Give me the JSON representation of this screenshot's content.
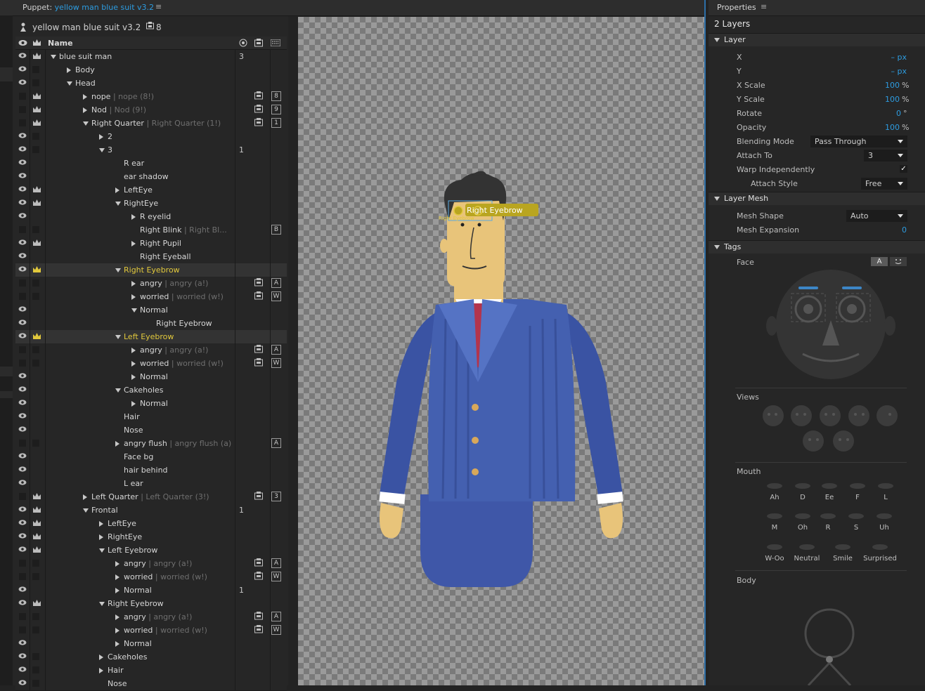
{
  "puppet_panel": {
    "title_label": "Puppet:",
    "title_value": "yellow man blue suit v3.2",
    "puppet_name": "yellow man blue suit v3.2",
    "layer_count": "8",
    "column_name": "Name",
    "rows": [
      {
        "label": "blue suit man",
        "sub": "",
        "indent": 0,
        "expand": "d",
        "eye": true,
        "crown": true,
        "num": "3",
        "key": "",
        "mic": false,
        "yellow": false,
        "sel": false
      },
      {
        "label": "Body",
        "sub": "",
        "indent": 1,
        "expand": "r",
        "eye": true,
        "crown": false,
        "num": "",
        "key": "",
        "mic": false,
        "yellow": false,
        "sel": false
      },
      {
        "label": "Head",
        "sub": "",
        "indent": 1,
        "expand": "d",
        "eye": true,
        "crown": false,
        "num": "",
        "key": "",
        "mic": false,
        "yellow": false,
        "sel": false
      },
      {
        "label": "nope",
        "sub": "nope (8!)",
        "indent": 2,
        "expand": "r",
        "eye": false,
        "crown": true,
        "num": "",
        "key": "8",
        "mic": true,
        "yellow": false,
        "sel": false
      },
      {
        "label": "Nod",
        "sub": "Nod (9!)",
        "indent": 2,
        "expand": "r",
        "eye": false,
        "crown": true,
        "num": "",
        "key": "9",
        "mic": true,
        "yellow": false,
        "sel": false
      },
      {
        "label": "Right Quarter",
        "sub": "Right Quarter (1!)",
        "indent": 2,
        "expand": "d",
        "eye": false,
        "crown": true,
        "num": "",
        "key": "1",
        "mic": true,
        "yellow": false,
        "sel": false
      },
      {
        "label": "2",
        "sub": "",
        "indent": 3,
        "expand": "r",
        "eye": true,
        "crown": false,
        "num": "",
        "key": "",
        "mic": false,
        "yellow": false,
        "sel": false
      },
      {
        "label": "3",
        "sub": "",
        "indent": 3,
        "expand": "d",
        "eye": true,
        "crown": false,
        "num": "1",
        "key": "",
        "mic": false,
        "yellow": false,
        "sel": false
      },
      {
        "label": "R ear",
        "sub": "",
        "indent": 4,
        "expand": "",
        "eye": true,
        "crown": false,
        "num": "",
        "key": "",
        "mic": false,
        "yellow": false,
        "sel": false
      },
      {
        "label": "ear shadow",
        "sub": "",
        "indent": 4,
        "expand": "",
        "eye": true,
        "crown": false,
        "num": "",
        "key": "",
        "mic": false,
        "yellow": false,
        "sel": false
      },
      {
        "label": "LeftEye",
        "sub": "",
        "indent": 4,
        "expand": "r",
        "eye": true,
        "crown": true,
        "num": "",
        "key": "",
        "mic": false,
        "yellow": false,
        "sel": false
      },
      {
        "label": "RightEye",
        "sub": "",
        "indent": 4,
        "expand": "d",
        "eye": true,
        "crown": true,
        "num": "",
        "key": "",
        "mic": false,
        "yellow": false,
        "sel": false
      },
      {
        "label": "R eyelid",
        "sub": "",
        "indent": 5,
        "expand": "r",
        "eye": true,
        "crown": false,
        "num": "",
        "key": "",
        "mic": false,
        "yellow": false,
        "sel": false
      },
      {
        "label": "Right Blink",
        "sub": "Right Bl...",
        "indent": 5,
        "expand": "",
        "eye": false,
        "crown": false,
        "num": "",
        "key": "B",
        "mic": false,
        "yellow": false,
        "sel": false
      },
      {
        "label": "Right Pupil",
        "sub": "",
        "indent": 5,
        "expand": "r",
        "eye": true,
        "crown": true,
        "num": "",
        "key": "",
        "mic": false,
        "yellow": false,
        "sel": false
      },
      {
        "label": "Right Eyeball",
        "sub": "",
        "indent": 5,
        "expand": "",
        "eye": true,
        "crown": false,
        "num": "",
        "key": "",
        "mic": false,
        "yellow": false,
        "sel": false
      },
      {
        "label": "Right Eyebrow",
        "sub": "",
        "indent": 4,
        "expand": "d",
        "eye": true,
        "crown": true,
        "num": "",
        "key": "",
        "mic": false,
        "yellow": true,
        "sel": true
      },
      {
        "label": "angry",
        "sub": "angry (a!)",
        "indent": 5,
        "expand": "r",
        "eye": false,
        "crown": false,
        "num": "",
        "key": "A",
        "mic": true,
        "yellow": false,
        "sel": false
      },
      {
        "label": "worried",
        "sub": "worried (w!)",
        "indent": 5,
        "expand": "r",
        "eye": false,
        "crown": false,
        "num": "",
        "key": "W",
        "mic": true,
        "yellow": false,
        "sel": false
      },
      {
        "label": "Normal",
        "sub": "",
        "indent": 5,
        "expand": "d",
        "eye": true,
        "crown": false,
        "num": "",
        "key": "",
        "mic": false,
        "yellow": false,
        "sel": false
      },
      {
        "label": "Right Eyebrow",
        "sub": "",
        "indent": 6,
        "expand": "",
        "eye": true,
        "crown": false,
        "num": "",
        "key": "",
        "mic": false,
        "yellow": false,
        "sel": false
      },
      {
        "label": "Left Eyebrow",
        "sub": "",
        "indent": 4,
        "expand": "d",
        "eye": true,
        "crown": true,
        "num": "",
        "key": "",
        "mic": false,
        "yellow": true,
        "sel": true
      },
      {
        "label": "angry",
        "sub": "angry (a!)",
        "indent": 5,
        "expand": "r",
        "eye": false,
        "crown": false,
        "num": "",
        "key": "A",
        "mic": true,
        "yellow": false,
        "sel": false
      },
      {
        "label": "worried",
        "sub": "worried (w!)",
        "indent": 5,
        "expand": "r",
        "eye": false,
        "crown": false,
        "num": "",
        "key": "W",
        "mic": true,
        "yellow": false,
        "sel": false
      },
      {
        "label": "Normal",
        "sub": "",
        "indent": 5,
        "expand": "r",
        "eye": true,
        "crown": false,
        "num": "",
        "key": "",
        "mic": false,
        "yellow": false,
        "sel": false
      },
      {
        "label": "Cakeholes",
        "sub": "",
        "indent": 4,
        "expand": "d",
        "eye": true,
        "crown": false,
        "num": "",
        "key": "",
        "mic": false,
        "yellow": false,
        "sel": false
      },
      {
        "label": "Normal",
        "sub": "",
        "indent": 5,
        "expand": "r",
        "eye": true,
        "crown": false,
        "num": "",
        "key": "",
        "mic": false,
        "yellow": false,
        "sel": false
      },
      {
        "label": "Hair",
        "sub": "",
        "indent": 4,
        "expand": "",
        "eye": true,
        "crown": false,
        "num": "",
        "key": "",
        "mic": false,
        "yellow": false,
        "sel": false
      },
      {
        "label": "Nose",
        "sub": "",
        "indent": 4,
        "expand": "",
        "eye": true,
        "crown": false,
        "num": "",
        "key": "",
        "mic": false,
        "yellow": false,
        "sel": false
      },
      {
        "label": "angry flush",
        "sub": "angry flush (a)",
        "indent": 4,
        "expand": "r",
        "eye": false,
        "crown": false,
        "num": "",
        "key": "A",
        "mic": false,
        "yellow": false,
        "sel": false
      },
      {
        "label": "Face bg",
        "sub": "",
        "indent": 4,
        "expand": "",
        "eye": true,
        "crown": false,
        "num": "",
        "key": "",
        "mic": false,
        "yellow": false,
        "sel": false
      },
      {
        "label": "hair behind",
        "sub": "",
        "indent": 4,
        "expand": "",
        "eye": true,
        "crown": false,
        "num": "",
        "key": "",
        "mic": false,
        "yellow": false,
        "sel": false
      },
      {
        "label": "L ear",
        "sub": "",
        "indent": 4,
        "expand": "",
        "eye": true,
        "crown": false,
        "num": "",
        "key": "",
        "mic": false,
        "yellow": false,
        "sel": false
      },
      {
        "label": "Left Quarter",
        "sub": "Left Quarter (3!)",
        "indent": 2,
        "expand": "r",
        "eye": false,
        "crown": true,
        "num": "",
        "key": "3",
        "mic": true,
        "yellow": false,
        "sel": false
      },
      {
        "label": "Frontal",
        "sub": "",
        "indent": 2,
        "expand": "d",
        "eye": true,
        "crown": true,
        "num": "1",
        "key": "",
        "mic": false,
        "yellow": false,
        "sel": false
      },
      {
        "label": "LeftEye",
        "sub": "",
        "indent": 3,
        "expand": "r",
        "eye": true,
        "crown": true,
        "num": "",
        "key": "",
        "mic": false,
        "yellow": false,
        "sel": false
      },
      {
        "label": "RightEye",
        "sub": "",
        "indent": 3,
        "expand": "r",
        "eye": true,
        "crown": true,
        "num": "",
        "key": "",
        "mic": false,
        "yellow": false,
        "sel": false
      },
      {
        "label": "Left Eyebrow",
        "sub": "",
        "indent": 3,
        "expand": "d",
        "eye": true,
        "crown": true,
        "num": "",
        "key": "",
        "mic": false,
        "yellow": false,
        "sel": false
      },
      {
        "label": "angry",
        "sub": "angry (a!)",
        "indent": 4,
        "expand": "r",
        "eye": false,
        "crown": false,
        "num": "",
        "key": "A",
        "mic": true,
        "yellow": false,
        "sel": false
      },
      {
        "label": "worried",
        "sub": "worried (w!)",
        "indent": 4,
        "expand": "r",
        "eye": false,
        "crown": false,
        "num": "",
        "key": "W",
        "mic": true,
        "yellow": false,
        "sel": false
      },
      {
        "label": "Normal",
        "sub": "",
        "indent": 4,
        "expand": "r",
        "eye": true,
        "crown": false,
        "num": "1",
        "key": "",
        "mic": false,
        "yellow": false,
        "sel": false
      },
      {
        "label": "Right Eyebrow",
        "sub": "",
        "indent": 3,
        "expand": "d",
        "eye": true,
        "crown": true,
        "num": "",
        "key": "",
        "mic": false,
        "yellow": false,
        "sel": false
      },
      {
        "label": "angry",
        "sub": "angry (a!)",
        "indent": 4,
        "expand": "r",
        "eye": false,
        "crown": false,
        "num": "",
        "key": "A",
        "mic": true,
        "yellow": false,
        "sel": false
      },
      {
        "label": "worried",
        "sub": "worried (w!)",
        "indent": 4,
        "expand": "r",
        "eye": false,
        "crown": false,
        "num": "",
        "key": "W",
        "mic": true,
        "yellow": false,
        "sel": false
      },
      {
        "label": "Normal",
        "sub": "",
        "indent": 4,
        "expand": "r",
        "eye": true,
        "crown": false,
        "num": "",
        "key": "",
        "mic": false,
        "yellow": false,
        "sel": false
      },
      {
        "label": "Cakeholes",
        "sub": "",
        "indent": 3,
        "expand": "r",
        "eye": true,
        "crown": false,
        "num": "",
        "key": "",
        "mic": false,
        "yellow": false,
        "sel": false
      },
      {
        "label": "Hair",
        "sub": "",
        "indent": 3,
        "expand": "r",
        "eye": true,
        "crown": false,
        "num": "",
        "key": "",
        "mic": false,
        "yellow": false,
        "sel": false
      },
      {
        "label": "Nose",
        "sub": "",
        "indent": 3,
        "expand": "",
        "eye": true,
        "crown": false,
        "num": "",
        "key": "",
        "mic": false,
        "yellow": false,
        "sel": false
      }
    ]
  },
  "canvas": {
    "handle_label": "Right Eyebrow",
    "handle_sub_label": "Right Eyebrow"
  },
  "properties": {
    "title": "Properties",
    "layers_count": "2 Layers",
    "layer_section": "Layer",
    "x_label": "X",
    "x_value": "– px",
    "y_label": "Y",
    "y_value": "– px",
    "xscale_label": "X Scale",
    "xscale_value": "100",
    "yscale_label": "Y Scale",
    "yscale_value": "100",
    "rotate_label": "Rotate",
    "rotate_value": "0",
    "opacity_label": "Opacity",
    "opacity_value": "100",
    "pct": "%",
    "deg": "°",
    "blend_label": "Blending Mode",
    "blend_value": "Pass Through",
    "attach_label": "Attach To",
    "attach_value": "3",
    "warp_label": "Warp Independently",
    "warp_checked": "✓",
    "attach_style_label": "Attach Style",
    "attach_style_value": "Free",
    "mesh_section": "Layer Mesh",
    "mesh_shape_label": "Mesh Shape",
    "mesh_shape_value": "Auto",
    "mesh_exp_label": "Mesh Expansion",
    "mesh_exp_value": "0",
    "tags_section": "Tags",
    "face_label": "Face",
    "face_btn_a": "A",
    "views_label": "Views",
    "mouth_label": "Mouth",
    "mouth_tags_row1": [
      "Ah",
      "D",
      "Ee",
      "F",
      "L"
    ],
    "mouth_tags_row2": [
      "M",
      "Oh",
      "R",
      "S",
      "Uh"
    ],
    "mouth_tags_row3": [
      "W-Oo",
      "Neutral",
      "Smile",
      "Surprised"
    ],
    "body_label": "Body"
  },
  "colors": {
    "accent": "#2d9ce0",
    "highlight": "#e1c83c",
    "suit": "#3f57a8",
    "skin": "#e8c47a",
    "tie": "#b3344c"
  }
}
